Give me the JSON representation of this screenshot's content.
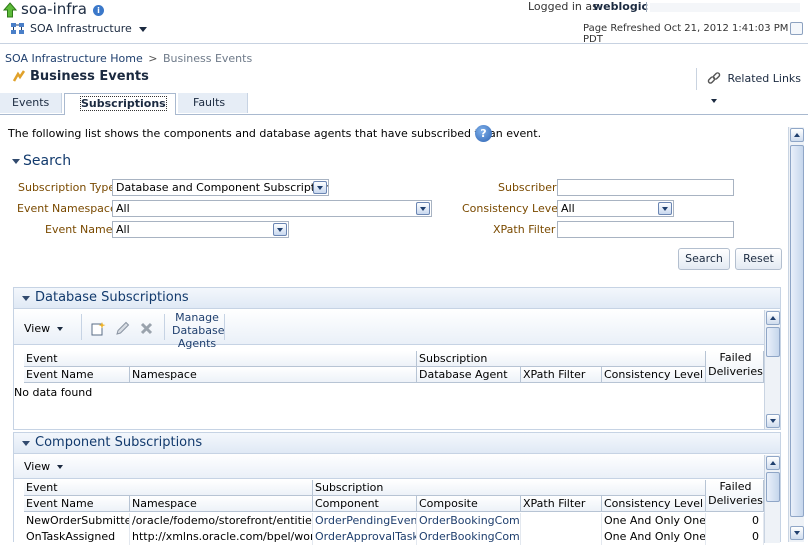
{
  "header": {
    "app_title": "soa-infra",
    "target_menu": "SOA Infrastructure",
    "logged_in_label": "Logged in as",
    "user": "weblogic",
    "page_refreshed": "Page Refreshed Oct 21, 2012 1:41:03 PM PDT"
  },
  "breadcrumb": {
    "home": "SOA Infrastructure Home",
    "separator": ">",
    "current": "Business Events"
  },
  "page_title": "Business Events",
  "related_links": "Related Links",
  "tabs": [
    {
      "label": "Events",
      "selected": false
    },
    {
      "label": "Subscriptions",
      "selected": true
    },
    {
      "label": "Faults",
      "selected": false
    }
  ],
  "intro_text": "The following list shows the components and database agents that have subscribed to an event.",
  "search": {
    "title": "Search",
    "subscription_type_label": "Subscription Type",
    "subscription_type_value": "Database and Component Subscriptions",
    "event_namespace_label": "Event Namespace",
    "event_namespace_value": "All",
    "event_name_label": "Event Name",
    "event_name_value": "All",
    "subscriber_label": "Subscriber",
    "subscriber_value": "",
    "consistency_level_label": "Consistency Level",
    "consistency_level_value": "All",
    "xpath_filter_label": "XPath Filter",
    "xpath_filter_value": "",
    "search_button": "Search",
    "reset_button": "Reset"
  },
  "db_subscriptions": {
    "title": "Database Subscriptions",
    "view_menu": "View",
    "manage_agents_line1": "Manage",
    "manage_agents_line2": "Database",
    "manage_agents_line3": "Agents",
    "group_event": "Event",
    "group_subscription": "Subscription",
    "failed_line1": "Failed",
    "failed_line2": "Deliveries",
    "columns": [
      "Event Name",
      "Namespace",
      "Database Agent",
      "XPath Filter",
      "Consistency Level"
    ],
    "empty_text": "No data found"
  },
  "component_subscriptions": {
    "title": "Component Subscriptions",
    "view_menu": "View",
    "group_event": "Event",
    "group_subscription": "Subscription",
    "failed_line1": "Failed",
    "failed_line2": "Deliveries",
    "columns": [
      "Event Name",
      "Namespace",
      "Component",
      "Composite",
      "XPath Filter",
      "Consistency Level"
    ],
    "rows": [
      {
        "event_name": "NewOrderSubmitted",
        "namespace": "/oracle/fodemo/storefront/entities/ev",
        "component": "OrderPendingEvent",
        "composite": "OrderBookingCompos",
        "xpath_filter": "",
        "consistency_level": "One And Only One",
        "failed": "0"
      },
      {
        "event_name": "OnTaskAssigned",
        "namespace": "http://xmlns.oracle.com/bpel/workflo",
        "component": "OrderApprovalTaskAs",
        "composite": "OrderBookingCompos",
        "xpath_filter": "",
        "consistency_level": "One And Only One",
        "failed": "0"
      }
    ]
  },
  "colors": {
    "link": "#1f3f6e",
    "label": "#7a4a00",
    "header_band": "#e0e9f5",
    "selected_tab": "#ffffff"
  }
}
